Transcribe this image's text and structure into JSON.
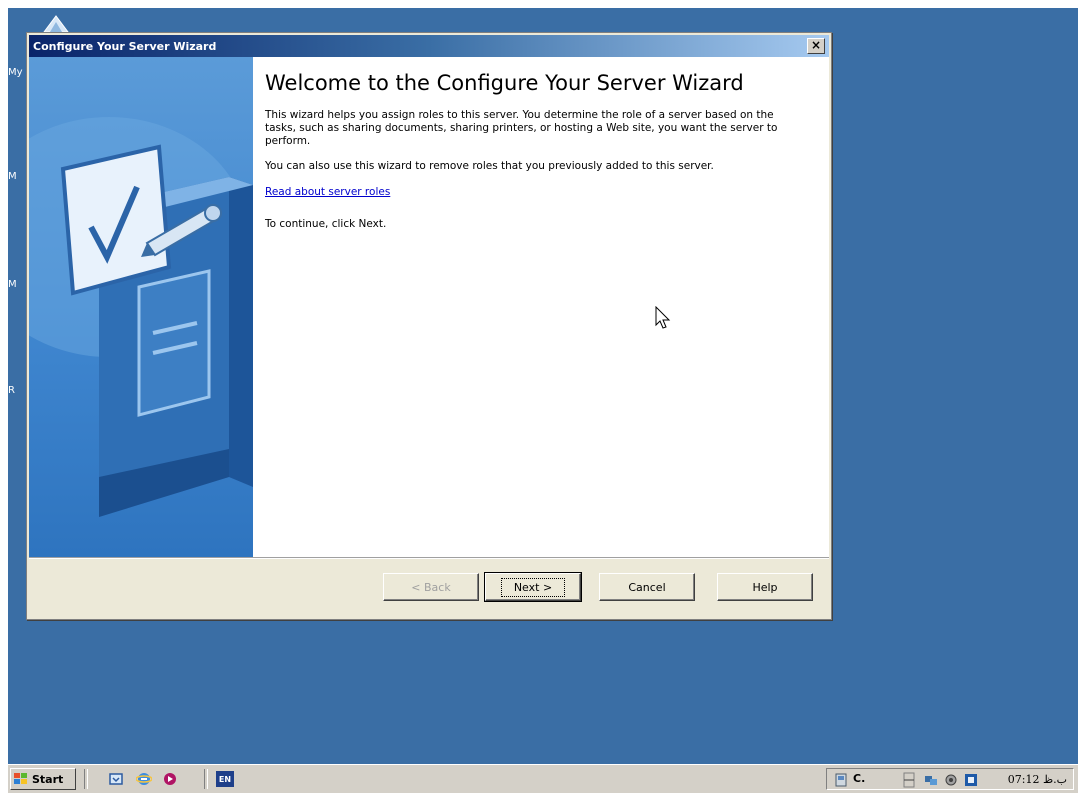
{
  "desktop": {
    "background_color": "#3a6ea5",
    "icon_label_stubs": [
      "My",
      "M",
      "M",
      "R"
    ]
  },
  "window": {
    "title": "Configure Your Server Wizard",
    "close_glyph": "×",
    "heading": "Welcome to the Configure Your Server Wizard",
    "paragraphs": [
      "This wizard helps you assign roles to this server. You determine the role of a server based on the tasks, such as sharing documents, sharing printers, or hosting a Web site, you want the server to perform.",
      "You can also use this wizard to remove roles that you previously added to this server."
    ],
    "link_text": "Read about server roles",
    "continue_text": "To continue, click Next."
  },
  "buttons": {
    "back": "< Back",
    "next": "Next >",
    "cancel": "Cancel",
    "help": "Help"
  },
  "taskbar": {
    "start_label": "start",
    "language": "EN",
    "tray_drive_label": "C.",
    "clock": "07:12 ب.ظ"
  },
  "colors": {
    "accent_title": "#0a246a",
    "banner_blue": "#3f86cf",
    "link": "#0000cc"
  },
  "icons": [
    "wizard-checklist-illustration",
    "windows-logo-icon",
    "desktop-icon",
    "ie-icon",
    "media-icon",
    "messenger-icon",
    "computer-tray-icon",
    "network-tray-icon",
    "volume-tray-icon",
    "security-tray-icon",
    "mouse-cursor-icon"
  ]
}
